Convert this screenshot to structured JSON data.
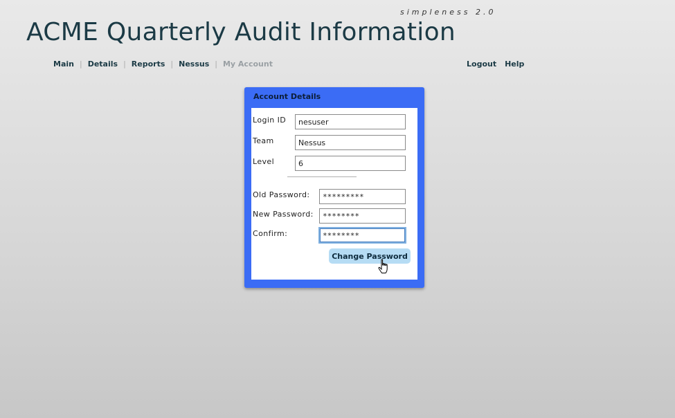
{
  "brand": {
    "tagline": "simpleness 2.0"
  },
  "header": {
    "title": "ACME Quarterly Audit Information"
  },
  "nav": {
    "main": "Main",
    "details": "Details",
    "reports": "Reports",
    "nessus": "Nessus",
    "my_account": "My Account",
    "logout": "Logout",
    "help": "Help"
  },
  "panel": {
    "title": "Account Details",
    "login_id_label": "Login ID",
    "login_id_value": "nesuser",
    "team_label": "Team",
    "team_value": "Nessus",
    "level_label": "Level",
    "level_value": "6",
    "old_password_label": "Old Password:",
    "old_password_value": "*********",
    "new_password_label": "New Password:",
    "new_password_value": "********",
    "confirm_label": "Confirm:",
    "confirm_value": "********",
    "change_password_button": "Change Password"
  },
  "colors": {
    "panel_blue": "#3b6cf5",
    "button_light_blue": "#b6dcf4",
    "title_text": "#1b3a45"
  },
  "icons": {
    "cursor": "hand-pointer-icon"
  }
}
